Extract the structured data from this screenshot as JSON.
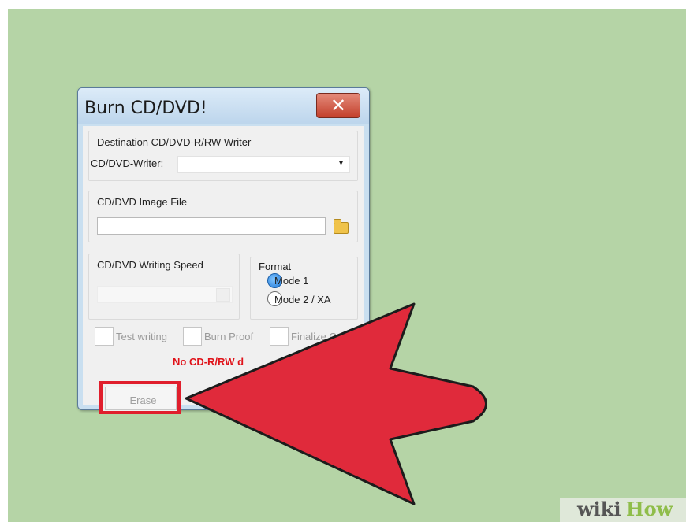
{
  "window": {
    "title": "Burn CD/DVD!",
    "close_glyph": "✕"
  },
  "destination": {
    "group_label": "Destination CD/DVD-R/RW Writer",
    "writer_label": "CD/DVD-Writer:",
    "writer_value": "",
    "dropdown_glyph": "▾"
  },
  "image_file": {
    "group_label": "CD/DVD Image File",
    "path_value": ""
  },
  "speed": {
    "group_label": "CD/DVD Writing Speed",
    "value": ""
  },
  "format": {
    "group_label": "Format",
    "options": [
      {
        "label": "Mode 1",
        "selected": true
      },
      {
        "label": "Mode 2 / XA",
        "selected": false
      }
    ]
  },
  "options": {
    "test_writing": "Test writing",
    "burn_proof": "Burn Proof",
    "finalize": "Finalize C"
  },
  "status_text": "No CD-R/RW d",
  "buttons": {
    "erase": "Erase"
  },
  "annotation": {
    "highlight_color": "#e01e2c",
    "arrow_color": "#e02a3b"
  },
  "watermark": {
    "part1": "wiki",
    "part2": "How"
  }
}
